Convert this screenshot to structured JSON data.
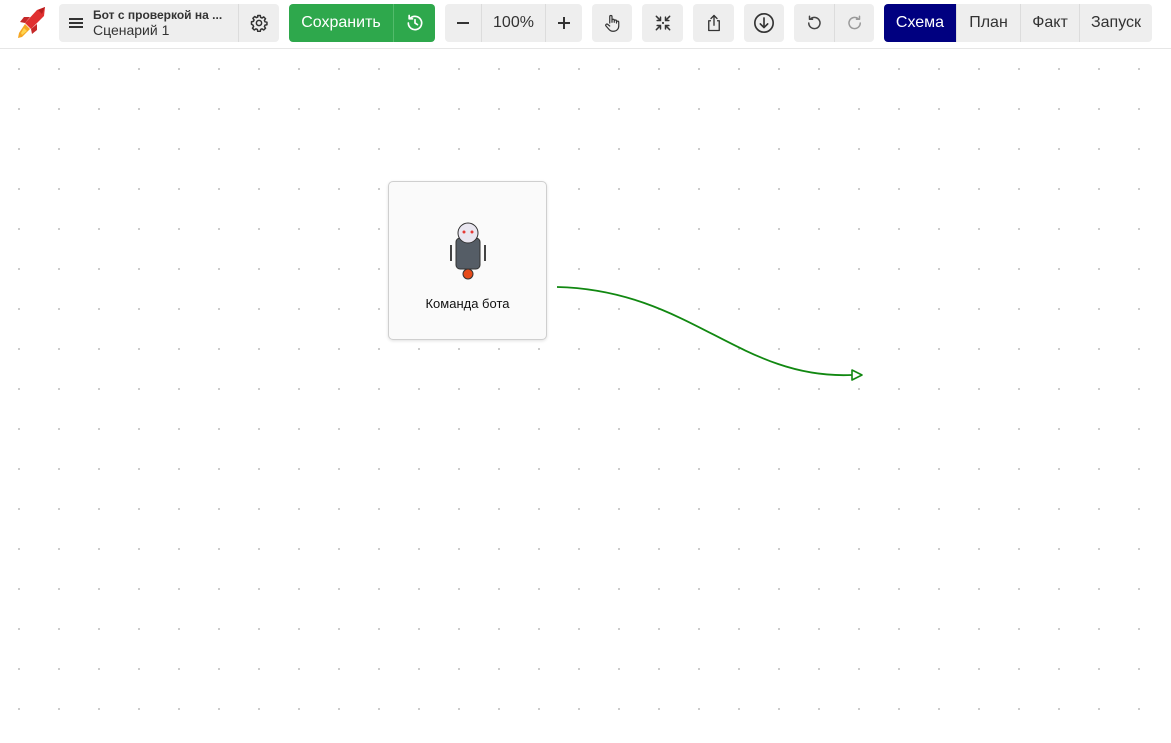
{
  "toolbar": {
    "logo_icon": "rocket-logo-icon",
    "menu_icon": "hamburger-icon",
    "project_name": "Бот с проверкой на ...",
    "scenario_name": "Сценарий 1",
    "settings_icon": "gear-icon",
    "save_label": "Сохранить",
    "history_icon": "history-clock-icon",
    "zoom_out_icon": "minus-icon",
    "zoom_level": "100%",
    "zoom_in_icon": "plus-icon",
    "hand_icon": "hand-pointer-icon",
    "fit_icon": "fit-to-screen-icon",
    "share_icon": "share-upload-icon",
    "download_icon": "download-circle-icon",
    "undo_icon": "undo-icon",
    "redo_icon": "redo-icon",
    "modes": [
      {
        "label": "Схема",
        "active": true
      },
      {
        "label": "План",
        "active": false
      },
      {
        "label": "Факт",
        "active": false
      },
      {
        "label": "Запуск",
        "active": false
      }
    ]
  },
  "canvas": {
    "nodes": [
      {
        "label": "Команда бота",
        "icon": "robot-icon"
      }
    ],
    "connector_color": "#118811"
  },
  "colors": {
    "save_green": "#2ea84c",
    "mode_active": "#000080",
    "toolbar_button_bg": "#eeeeee"
  }
}
